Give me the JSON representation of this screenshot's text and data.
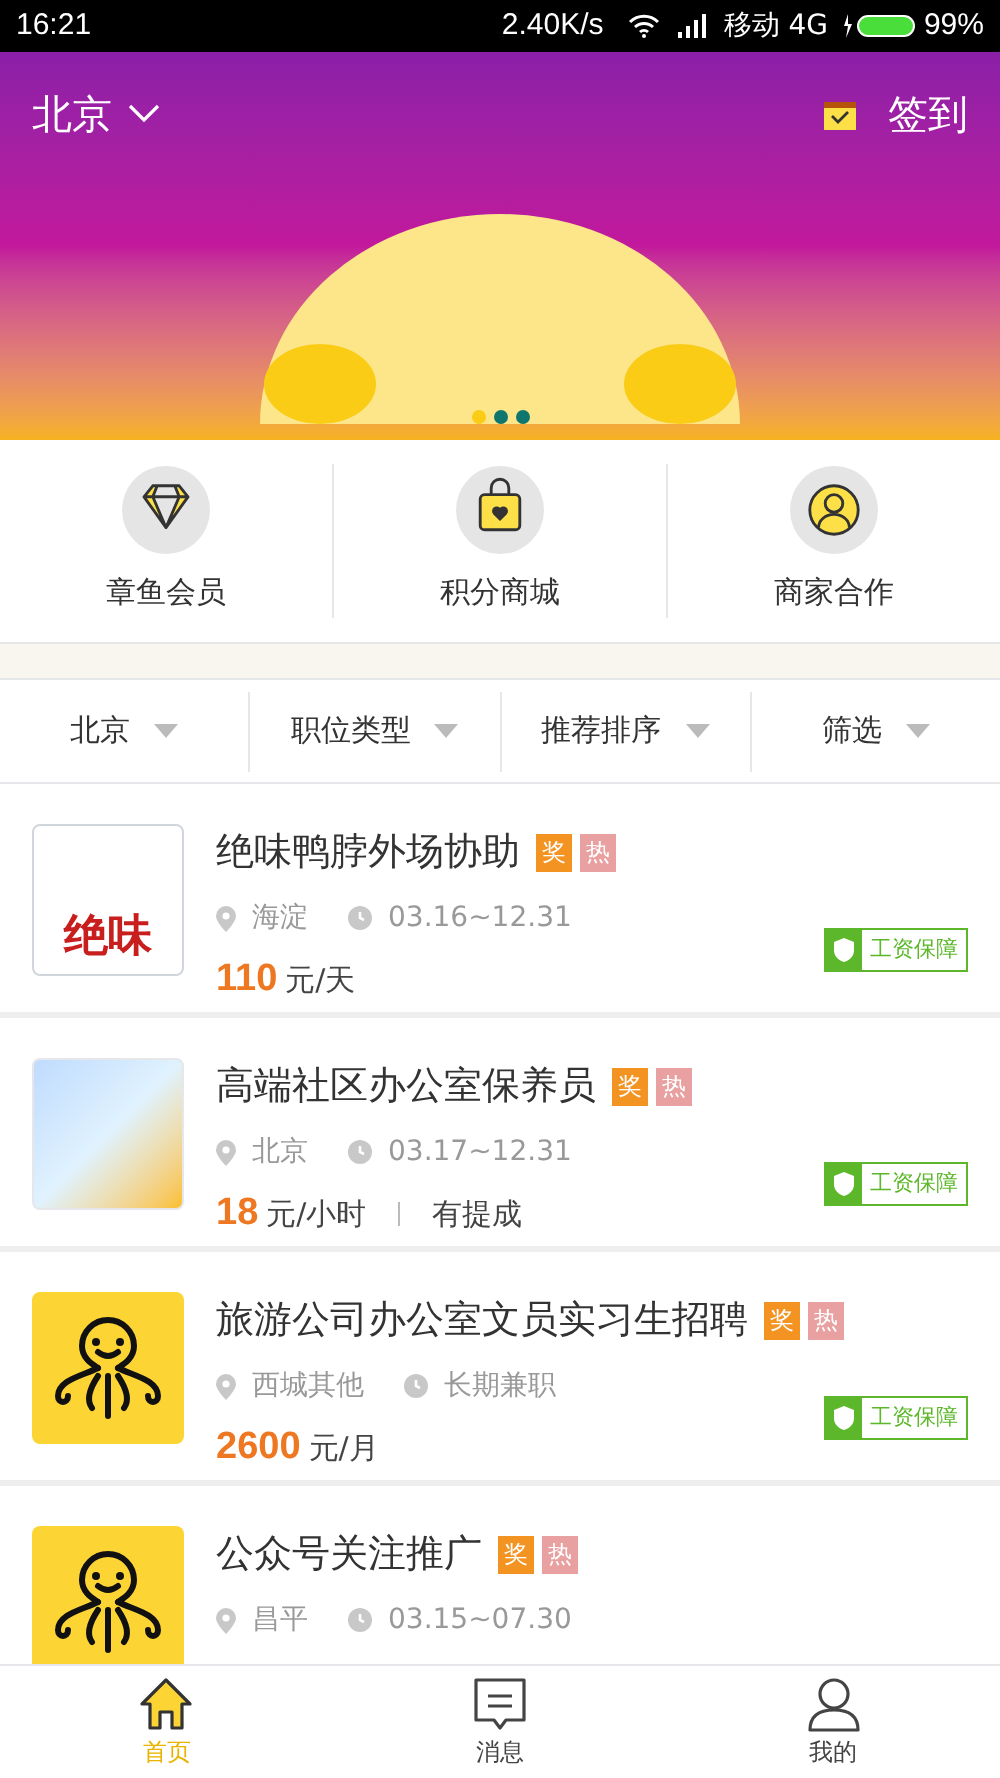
{
  "status_bar": {
    "time": "16:21",
    "speed": "2.40K/s",
    "carrier": "移动 4G",
    "battery": "99%"
  },
  "header": {
    "city": "北京",
    "sign_in": "签到"
  },
  "banner": {
    "dots": [
      {
        "selected": true
      },
      {
        "selected": false
      },
      {
        "selected": false
      }
    ]
  },
  "shortcuts": [
    {
      "label": "章鱼会员",
      "kind": "diamond"
    },
    {
      "label": "积分商城",
      "kind": "bag"
    },
    {
      "label": "商家合作",
      "kind": "person"
    }
  ],
  "filters": [
    {
      "label": "北京"
    },
    {
      "label": "职位类型"
    },
    {
      "label": "推荐排序"
    },
    {
      "label": "筛选"
    }
  ],
  "jobs": [
    {
      "title": "绝味鸭脖外场协助",
      "kind": "brand",
      "logo_text": "绝味",
      "tags": [
        {
          "text": "奖",
          "kind": "award"
        },
        {
          "text": "热",
          "kind": "hot"
        }
      ],
      "location": "海淀",
      "time": "03.16~12.31",
      "price": "110",
      "unit": "元/天",
      "badge": "工资保障"
    },
    {
      "title": "高端社区办公室保养员",
      "kind": "photo",
      "tags": [
        {
          "text": "奖",
          "kind": "award"
        },
        {
          "text": "热",
          "kind": "hot"
        }
      ],
      "location": "北京",
      "time": "03.17~12.31",
      "price": "18",
      "unit": "元/小时",
      "extra": "有提成",
      "badge": "工资保障"
    },
    {
      "title": "旅游公司办公室文员实习生招聘",
      "kind": "octopus",
      "tags": [
        {
          "text": "奖",
          "kind": "award"
        },
        {
          "text": "热",
          "kind": "hot"
        }
      ],
      "location": "西城其他",
      "time": "长期兼职",
      "price": "2600",
      "unit": "元/月",
      "badge": "工资保障"
    },
    {
      "title": "公众号关注推广",
      "kind": "octopus",
      "tags": [
        {
          "text": "奖",
          "kind": "award"
        },
        {
          "text": "热",
          "kind": "hot"
        }
      ],
      "location": "昌平",
      "time": "03.15~07.30"
    }
  ],
  "tabbar": [
    {
      "label": "首页",
      "kind": "home",
      "selected": true
    },
    {
      "label": "消息",
      "kind": "message",
      "selected": false
    },
    {
      "label": "我的",
      "kind": "profile",
      "selected": false
    }
  ]
}
